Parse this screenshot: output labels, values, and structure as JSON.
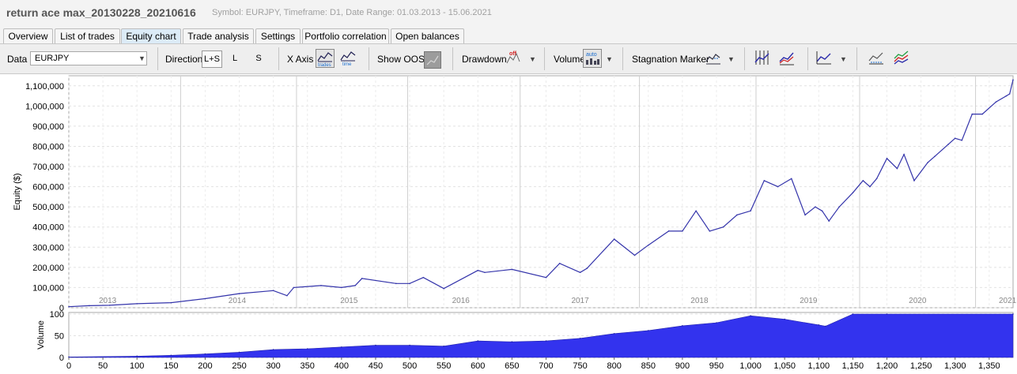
{
  "header": {
    "title": "return ace max_20130228_20210616",
    "subtitle": "Symbol: EURJPY, Timeframe: D1, Date Range: 01.03.2013 - 15.06.2021"
  },
  "tabs": [
    {
      "label": "Overview",
      "active": false
    },
    {
      "label": "List of trades",
      "active": false
    },
    {
      "label": "Equity chart",
      "active": true
    },
    {
      "label": "Trade analysis",
      "active": false
    },
    {
      "label": "Settings",
      "active": false
    },
    {
      "label": "Portfolio correlation",
      "active": false
    },
    {
      "label": "Open balances",
      "active": false
    }
  ],
  "toolbar": {
    "data_label": "Data",
    "data_value": "EURJPY",
    "direction_label": "Direction",
    "direction_options": [
      "L+S",
      "L",
      "S"
    ],
    "direction_selected": "L+S",
    "xaxis_label": "X Axis",
    "xaxis_trades": "trades",
    "xaxis_time": "time",
    "show_oos_label": "Show OOS",
    "drawdown_label": "Drawdown",
    "drawdown_state": "off",
    "volume_label": "Volume",
    "volume_state": "auto",
    "stagnation_label": "Stagnation Marker"
  },
  "chart_data": [
    {
      "type": "line",
      "ylabel": "Equity ($)",
      "ylim": [
        0,
        1150000
      ],
      "yticks": [
        "0",
        "100,000",
        "200,000",
        "300,000",
        "400,000",
        "500,000",
        "600,000",
        "700,000",
        "800,000",
        "900,000",
        "1,000,000",
        "1,100,000"
      ],
      "ytick_values": [
        0,
        100000,
        200000,
        300000,
        400000,
        500000,
        600000,
        700000,
        800000,
        900000,
        1000000,
        1100000
      ],
      "year_labels": [
        "2013",
        "2014",
        "2015",
        "2016",
        "2017",
        "2018",
        "2019",
        "2020",
        "2021"
      ],
      "year_label_trades": [
        57,
        247,
        411,
        575,
        750,
        925,
        1085,
        1245,
        1377
      ],
      "year_boundaries": [
        164,
        334,
        497,
        662,
        837,
        1008,
        1160,
        1330
      ],
      "series": [
        {
          "color": "#3333aa",
          "x": [
            0,
            30,
            60,
            100,
            150,
            200,
            250,
            300,
            320,
            330,
            370,
            400,
            420,
            430,
            480,
            500,
            520,
            550,
            600,
            610,
            650,
            700,
            720,
            750,
            760,
            800,
            830,
            850,
            880,
            900,
            920,
            940,
            960,
            980,
            1000,
            1020,
            1040,
            1060,
            1080,
            1095,
            1105,
            1115,
            1130,
            1150,
            1165,
            1175,
            1185,
            1200,
            1215,
            1225,
            1240,
            1260,
            1270,
            1290,
            1300,
            1310,
            1325,
            1340,
            1360,
            1375,
            1380,
            1385
          ],
          "values": [
            5000,
            10000,
            12000,
            20000,
            25000,
            45000,
            70000,
            85000,
            60000,
            100000,
            110000,
            100000,
            110000,
            145000,
            120000,
            120000,
            150000,
            95000,
            185000,
            175000,
            190000,
            150000,
            220000,
            175000,
            195000,
            340000,
            260000,
            310000,
            380000,
            380000,
            480000,
            380000,
            400000,
            460000,
            480000,
            630000,
            600000,
            640000,
            460000,
            500000,
            480000,
            430000,
            500000,
            570000,
            630000,
            600000,
            640000,
            740000,
            690000,
            760000,
            630000,
            720000,
            750000,
            810000,
            840000,
            830000,
            960000,
            960000,
            1020000,
            1050000,
            1060000,
            1130000
          ]
        }
      ]
    },
    {
      "type": "area",
      "ylabel": "Volume",
      "ylim": [
        0,
        100
      ],
      "yticks": [
        "0",
        "50",
        "100"
      ],
      "ytick_values": [
        0,
        50,
        100
      ],
      "xticks": [
        "0",
        "50",
        "100",
        "150",
        "200",
        "250",
        "300",
        "350",
        "400",
        "450",
        "500",
        "550",
        "600",
        "650",
        "700",
        "750",
        "800",
        "850",
        "900",
        "950",
        "1,000",
        "1,050",
        "1,100",
        "1,150",
        "1,200",
        "1,250",
        "1,300",
        "1,350"
      ],
      "xtick_values": [
        0,
        50,
        100,
        150,
        200,
        250,
        300,
        350,
        400,
        450,
        500,
        550,
        600,
        650,
        700,
        750,
        800,
        850,
        900,
        950,
        1000,
        1050,
        1100,
        1150,
        1200,
        1250,
        1300,
        1350
      ],
      "xlim": [
        0,
        1385
      ],
      "series": [
        {
          "color": "#3333ee",
          "x": [
            0,
            100,
            150,
            200,
            250,
            300,
            350,
            400,
            450,
            500,
            550,
            600,
            650,
            700,
            750,
            800,
            850,
            900,
            950,
            1000,
            1050,
            1100,
            1110,
            1150,
            1200,
            1385
          ],
          "values": [
            1,
            3,
            5,
            8,
            12,
            18,
            20,
            24,
            28,
            28,
            26,
            38,
            36,
            38,
            44,
            55,
            62,
            73,
            80,
            96,
            88,
            75,
            72,
            100,
            100,
            100
          ]
        }
      ]
    }
  ]
}
